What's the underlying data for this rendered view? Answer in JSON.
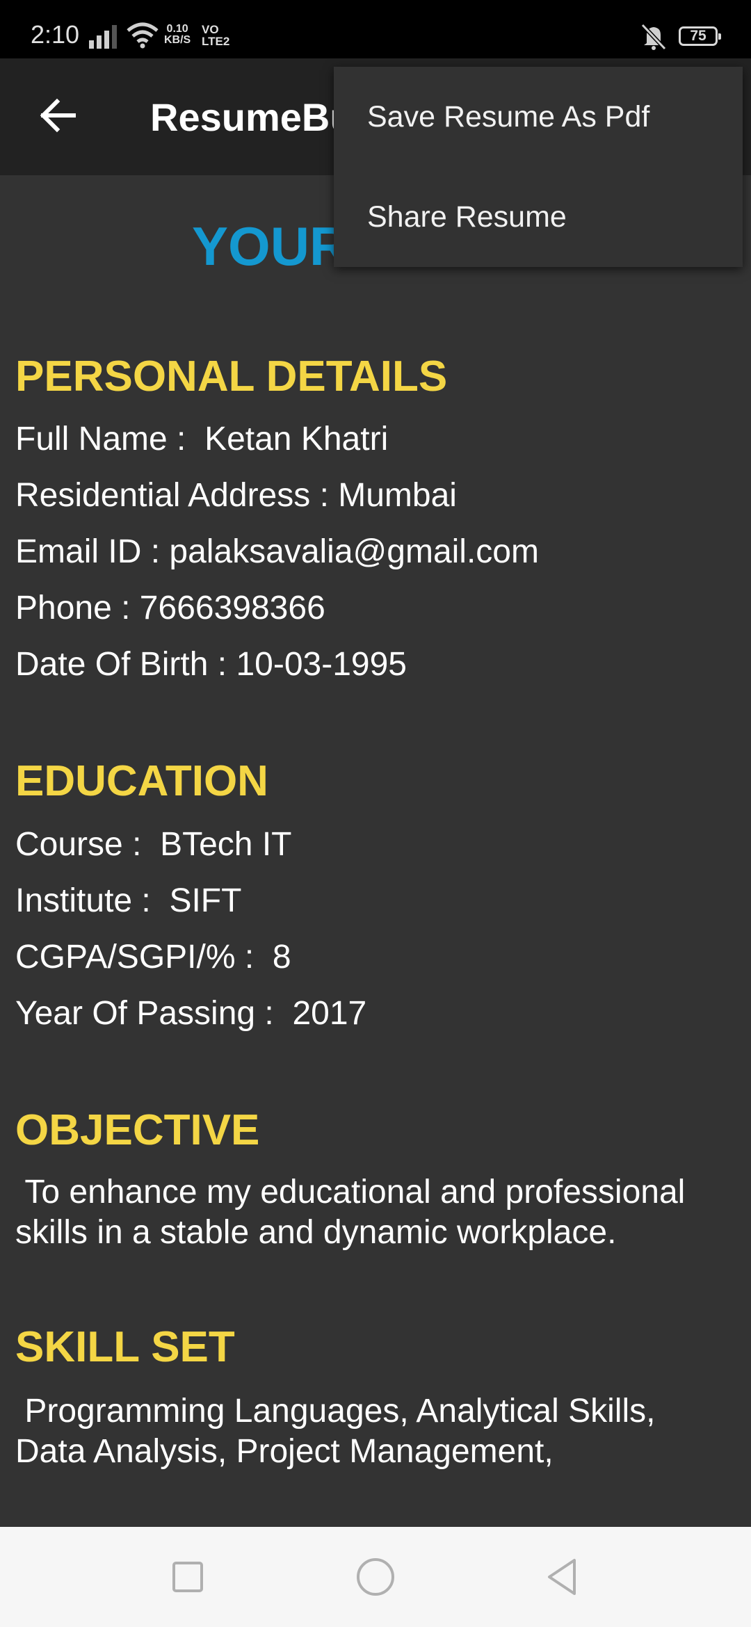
{
  "status_bar": {
    "time": "2:10",
    "net_speed_value": "0.10",
    "net_speed_unit": "KB/S",
    "volte_top": "VO",
    "volte_bottom": "LTE2",
    "battery": "75",
    "icons": [
      "signal-icon",
      "wifi-icon",
      "mute-vibrate-icon",
      "battery-icon"
    ]
  },
  "app_bar": {
    "title": "ResumeBu",
    "back_icon": "arrow-left-icon"
  },
  "menu": {
    "items": [
      {
        "label": "Save Resume As Pdf"
      },
      {
        "label": "Share Resume"
      }
    ]
  },
  "content": {
    "heading": "YOUR",
    "personal": {
      "title": "PERSONAL DETAILS",
      "lines": [
        "Full Name :  Ketan Khatri",
        "Residential Address : Mumbai",
        "Email ID : palaksavalia@gmail.com",
        "Phone : 7666398366",
        "Date Of Birth : 10-03-1995"
      ]
    },
    "education": {
      "title": "EDUCATION",
      "lines": [
        "Course :  BTech IT",
        "Institute :  SIFT",
        "CGPA/SGPI/% :  8",
        "Year Of Passing :  2017"
      ]
    },
    "objective": {
      "title": "OBJECTIVE",
      "text": " To enhance my educational and professional\nskills in a stable and dynamic workplace."
    },
    "skills": {
      "title": "SKILL SET",
      "text": " Programming Languages, Analytical Skills,\nData Analysis, Project Management,"
    }
  },
  "colors": {
    "background": "#333333",
    "heading_blue": "#1498d0",
    "section_yellow": "#f4d645",
    "app_bar": "#222222",
    "menu": "#323232"
  },
  "nav_bar": {
    "icons": [
      "recents-square-icon",
      "home-circle-icon",
      "back-triangle-icon"
    ]
  }
}
